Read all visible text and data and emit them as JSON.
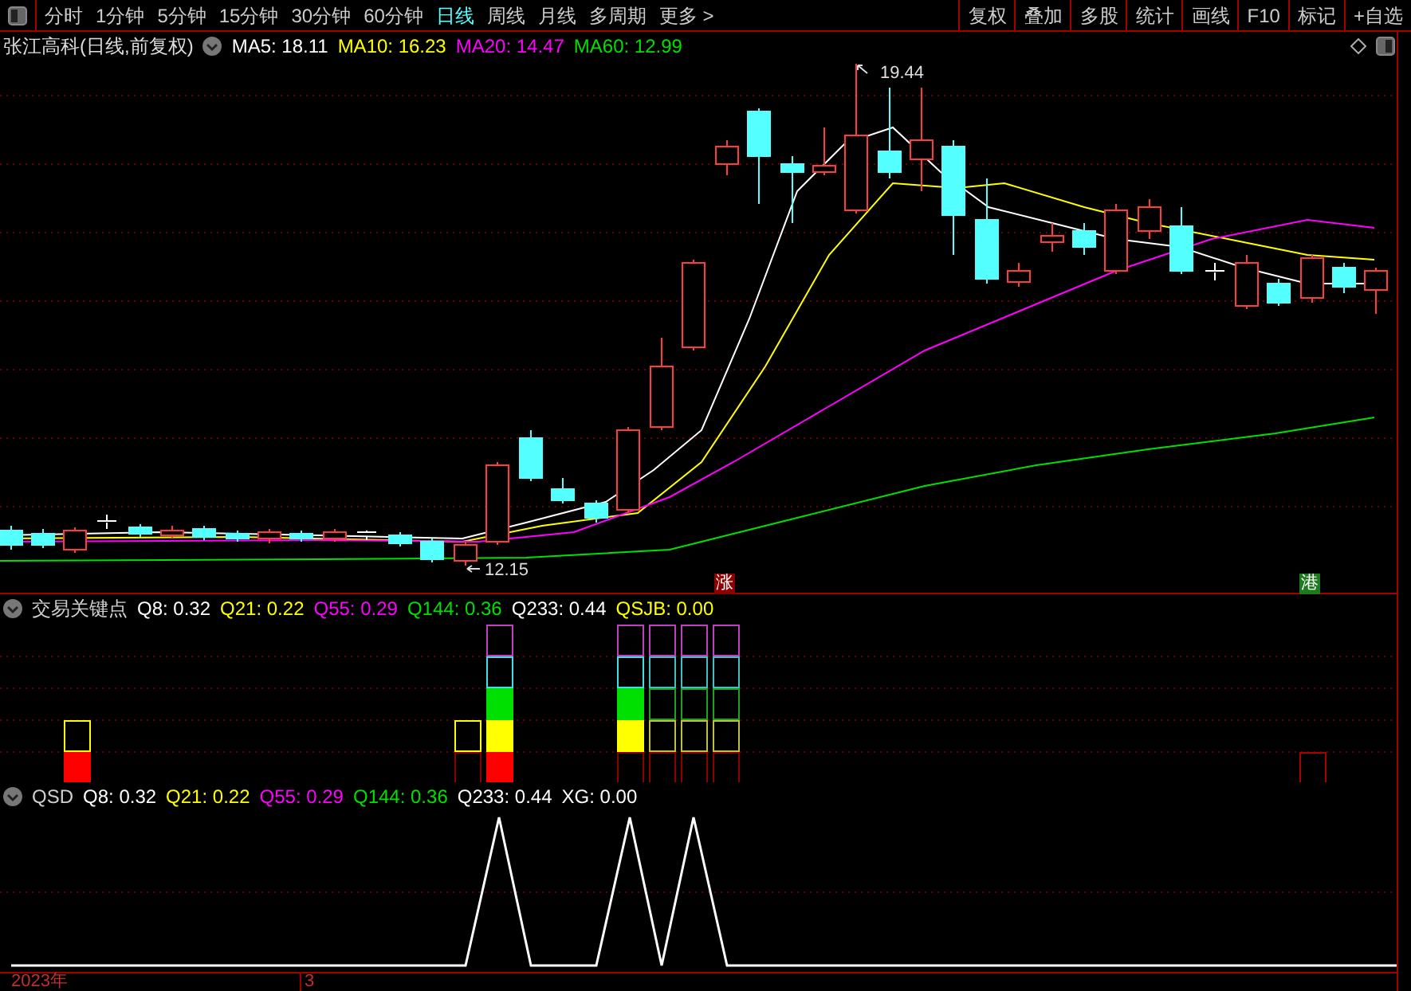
{
  "period_tabs": [
    {
      "label": "分时",
      "selected": false
    },
    {
      "label": "1分钟",
      "selected": false
    },
    {
      "label": "5分钟",
      "selected": false
    },
    {
      "label": "15分钟",
      "selected": false
    },
    {
      "label": "30分钟",
      "selected": false
    },
    {
      "label": "60分钟",
      "selected": false
    },
    {
      "label": "日线",
      "selected": true
    },
    {
      "label": "周线",
      "selected": false
    },
    {
      "label": "月线",
      "selected": false
    },
    {
      "label": "多周期",
      "selected": false
    },
    {
      "label": "更多 >",
      "selected": false
    }
  ],
  "toolbar_buttons": [
    "复权",
    "叠加",
    "多股",
    "统计",
    "画线",
    "F10",
    "标记",
    "+自选"
  ],
  "main_chart": {
    "title": "张江高科(日线,前复权)",
    "legend": [
      {
        "label": "MA5: 18.11",
        "color": "#ffffff"
      },
      {
        "label": "MA10: 16.23",
        "color": "#ffff00"
      },
      {
        "label": "MA20: 14.47",
        "color": "#ff00ff"
      },
      {
        "label": "MA60: 12.99",
        "color": "#00e000"
      }
    ],
    "high_label": "19.44",
    "low_label": "12.15",
    "markers": [
      {
        "label": "涨",
        "color": "#8b0000"
      },
      {
        "label": "港",
        "color": "#1f7a1f"
      }
    ]
  },
  "indicator_panels": [
    {
      "title": "交易关键点",
      "legend": [
        {
          "label": "Q8: 0.32",
          "color": "#ffffff"
        },
        {
          "label": "Q21: 0.22",
          "color": "#ffff00"
        },
        {
          "label": "Q55: 0.29",
          "color": "#ff00ff"
        },
        {
          "label": "Q144: 0.36",
          "color": "#00e000"
        },
        {
          "label": "Q233: 0.44",
          "color": "#ffffff"
        },
        {
          "label": "QSJB: 0.00",
          "color": "#ffff00"
        }
      ]
    },
    {
      "title": "QSD",
      "legend": [
        {
          "label": "Q8: 0.32",
          "color": "#ffffff"
        },
        {
          "label": "Q21: 0.22",
          "color": "#ffff00"
        },
        {
          "label": "Q55: 0.29",
          "color": "#ff00ff"
        },
        {
          "label": "Q144: 0.36",
          "color": "#00e000"
        },
        {
          "label": "Q233: 0.44",
          "color": "#ffffff"
        },
        {
          "label": "XG: 0.00",
          "color": "#ffffff"
        }
      ]
    }
  ],
  "time_axis": [
    "2023年",
    "3"
  ]
}
